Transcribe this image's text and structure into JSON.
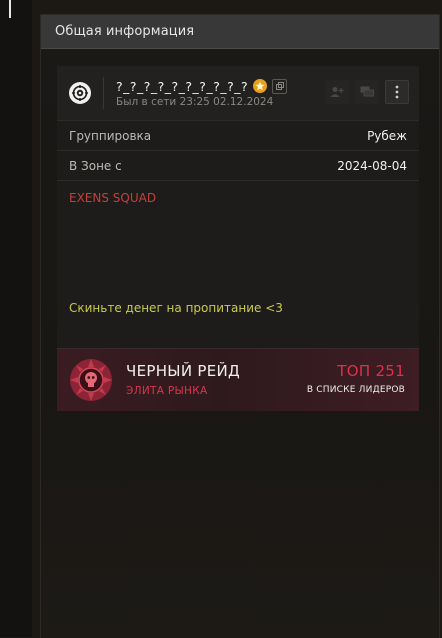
{
  "panel": {
    "title": "Общая информация"
  },
  "profile": {
    "name": "?_?_?_?_?_?_?_?_?_?",
    "last_seen": "Был в сети 23:25 02.12.2024"
  },
  "info_rows": [
    {
      "label": "Группировка",
      "value": "Рубеж"
    },
    {
      "label": "В Зоне с",
      "value": "2024-08-04"
    }
  ],
  "bio": {
    "title": "EXENS SQUAD",
    "note": "Скиньте денег на пропитание <3"
  },
  "raid": {
    "name": "ЧЕРНЫЙ РЕЙД",
    "subtitle": "ЭЛИТА РЫНКА",
    "rank": "ТОП 251",
    "rank_caption": "В СПИСКЕ ЛИДЕРОВ"
  },
  "icons": {
    "avatar": "target-emblem-icon",
    "badge": "gold-badge-icon",
    "copy": "copy-icon",
    "add_friend": "add-friend-icon",
    "chat": "chat-icon",
    "more": "more-vertical-icon",
    "raid": "raid-emblem-icon"
  },
  "colors": {
    "bio_title": "#c4403c",
    "bio_note": "#c9cc4c",
    "raid_accent": "#e03048",
    "badge_gold": "#e6a21c"
  }
}
